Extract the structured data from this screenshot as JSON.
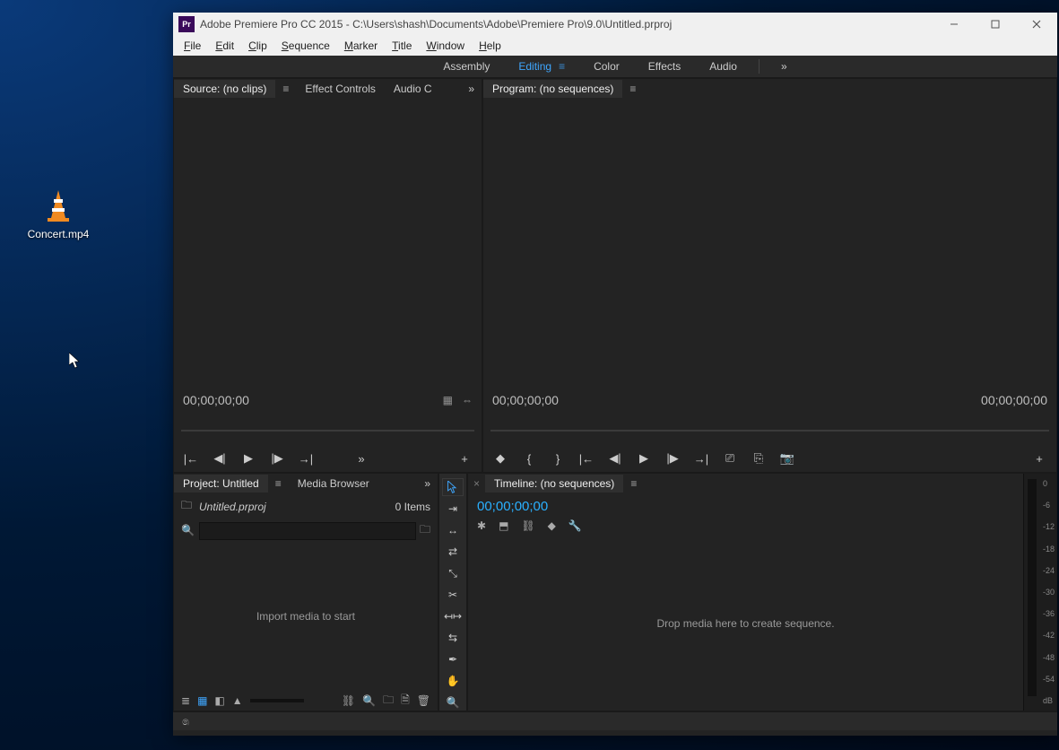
{
  "desktop": {
    "file_label": "Concert.mp4"
  },
  "window": {
    "title": "Adobe Premiere Pro CC 2015 - C:\\Users\\shash\\Documents\\Adobe\\Premiere Pro\\9.0\\Untitled.prproj",
    "app_icon_text": "Pr"
  },
  "menubar": {
    "items": [
      {
        "full": "File",
        "u": "F",
        "rest": "ile"
      },
      {
        "full": "Edit",
        "u": "E",
        "rest": "dit"
      },
      {
        "full": "Clip",
        "u": "C",
        "rest": "lip"
      },
      {
        "full": "Sequence",
        "u": "S",
        "rest": "equence"
      },
      {
        "full": "Marker",
        "u": "M",
        "rest": "arker"
      },
      {
        "full": "Title",
        "u": "T",
        "rest": "itle"
      },
      {
        "full": "Window",
        "u": "W",
        "rest": "indow"
      },
      {
        "full": "Help",
        "u": "H",
        "rest": "elp"
      }
    ]
  },
  "workspace": {
    "tabs": [
      "Assembly",
      "Editing",
      "Color",
      "Effects",
      "Audio"
    ],
    "active": "Editing",
    "overflow": "»"
  },
  "source": {
    "tabs": [
      "Source: (no clips)",
      "Effect Controls",
      "Audio C"
    ],
    "active": 0,
    "overflow": "»",
    "timecode": "00;00;00;00"
  },
  "program": {
    "tab": "Program: (no sequences)",
    "timecode_left": "00;00;00;00",
    "timecode_right": "00;00;00;00"
  },
  "project": {
    "tabs": [
      "Project: Untitled",
      "Media Browser"
    ],
    "active": 0,
    "overflow": "»",
    "filename": "Untitled.prproj",
    "item_count": "0 Items",
    "message": "Import media to start"
  },
  "tools": [
    "selection",
    "track-select",
    "ripple-edit",
    "rolling-edit",
    "rate-stretch",
    "razor",
    "slip",
    "slide",
    "pen",
    "hand",
    "zoom"
  ],
  "timeline": {
    "tab": "Timeline: (no sequences)",
    "timecode": "00;00;00;00",
    "message": "Drop media here to create sequence."
  },
  "audio_meter": {
    "scale": [
      "0",
      "-6",
      "-12",
      "-18",
      "-24",
      "-30",
      "-36",
      "-42",
      "-48",
      "-54",
      "dB"
    ]
  }
}
